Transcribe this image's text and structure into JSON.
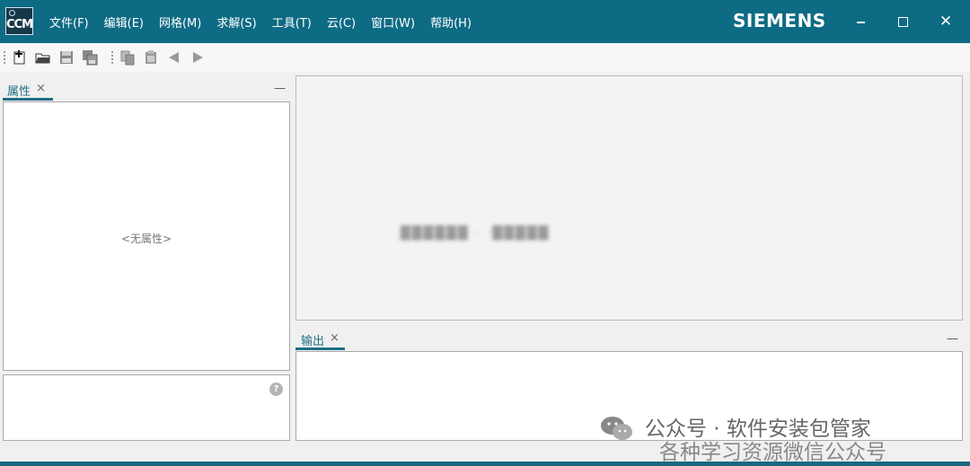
{
  "app": {
    "logo_text": "CCM",
    "brand": "SIEMENS"
  },
  "menu": {
    "items": [
      "文件(F)",
      "编辑(E)",
      "网格(M)",
      "求解(S)",
      "工具(T)",
      "云(C)",
      "窗口(W)",
      "帮助(H)"
    ]
  },
  "window_controls": {
    "close_glyph": "✕"
  },
  "toolbar": {
    "icons": [
      "new-simulation-icon",
      "open-icon",
      "save-icon",
      "save-as-icon",
      "copy-icon",
      "paste-icon",
      "back-icon",
      "forward-icon"
    ]
  },
  "properties_panel": {
    "tab_label": "属性",
    "tab_close": "×",
    "minimize": "—",
    "empty_text": "<无属性>",
    "help_glyph": "?"
  },
  "viewport": {
    "blurred_text": "██████ · ·█████"
  },
  "output_panel": {
    "tab_label": "输出",
    "tab_close": "×",
    "minimize": "—"
  },
  "watermark": {
    "line1": "公众号 · 软件安装包管家",
    "line2": "各种学习资源微信公众号"
  },
  "colors": {
    "titlebar": "#0e6b84",
    "tab_accent": "#1e6f85"
  }
}
